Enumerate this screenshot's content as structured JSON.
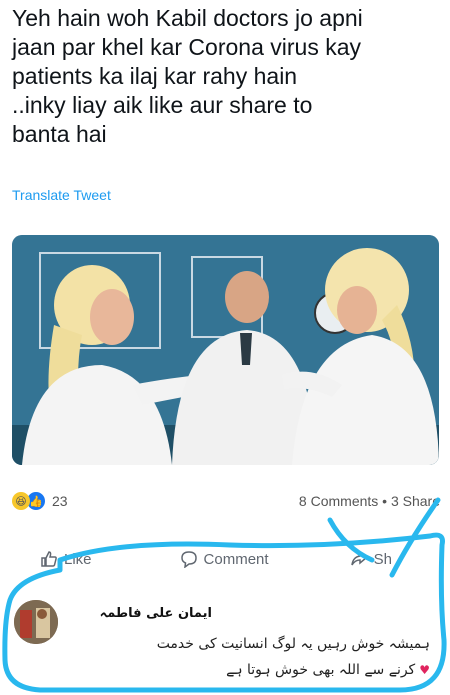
{
  "tweet": {
    "text": "Yeh hain woh Kabil doctors jo apni\njaan par khel kar Corona virus kay\npatients ka ilaj kar rahy hain\n..inky liay aik like aur share to\nbanta hai",
    "translate_label": "Translate Tweet"
  },
  "post_stats": {
    "reaction_count": "23",
    "comments_shares": "8 Comments • 3 Share"
  },
  "actions": {
    "like_label": "Like",
    "comment_label": "Comment",
    "share_label": "Sh"
  },
  "comment": {
    "author": "ایمان علی فاطمہ",
    "line1": "ہمیشہ خوش رہیں یہ لوگ انسانیت کی خدمت",
    "line2": "کرنے سے اللہ بھی خوش ہوتا ہے"
  },
  "colors": {
    "link_blue": "#1d9bf0",
    "like_blue": "#1877f2",
    "marker_cyan": "#29b8ee"
  }
}
